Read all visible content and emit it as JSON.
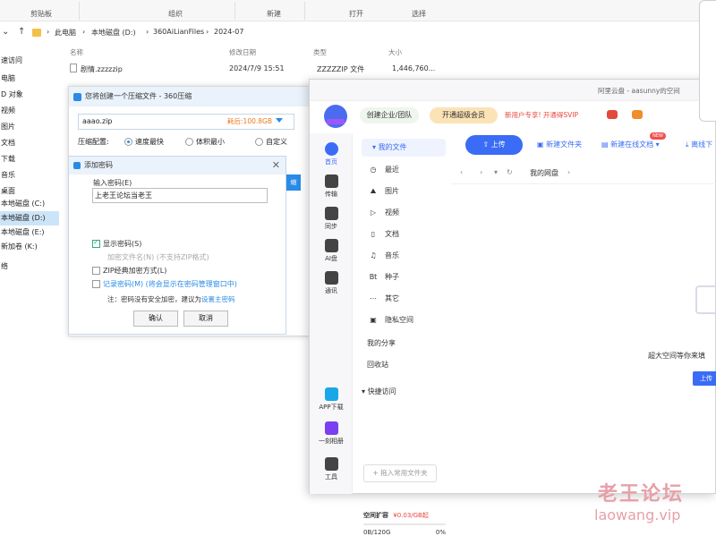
{
  "explorer": {
    "ribbon_groups": [
      "剪贴板",
      "组织",
      "新建",
      "打开",
      "选择"
    ],
    "breadcrumb": [
      "此电脑",
      "本地磁盘 (D:)",
      "360AiLianFiles",
      "2024-07"
    ],
    "tree": [
      "速访问",
      "电脑",
      "D 对象",
      "视频",
      "图片",
      "文档",
      "下载",
      "音乐",
      "桌面",
      "本地磁盘 (C:)",
      "本地磁盘 (D:)",
      "本地磁盘 (E:)",
      "新加卷 (K:)",
      "络"
    ],
    "columns": [
      "名称",
      "修改日期",
      "类型",
      "大小"
    ],
    "files": [
      {
        "name": "剧情.zzzzzip",
        "date": "2024/7/9 15:51",
        "type": "ZZZZZIP 文件",
        "size": "1,446,760..."
      }
    ]
  },
  "compress_dialog": {
    "title": "您将创建一个压缩文件 - 360压缩",
    "filename": "aaao.zip",
    "ratio": "耗后:100.8GB",
    "config_label": "压缩配置:",
    "options": [
      "速度最快",
      "体积最小",
      "自定义"
    ],
    "selected_option": "速度最快",
    "side_tab": "缩"
  },
  "password_dialog": {
    "title": "添加密码",
    "input_label": "输入密码(E)",
    "password_value": "上老王论坛当老王",
    "checks": [
      {
        "label": "显示密码(S)",
        "checked": true,
        "state": "normal"
      },
      {
        "label": "加密文件名(N) (不支持ZIP格式)",
        "checked": false,
        "state": "disabled"
      },
      {
        "label": "ZIP经典加密方式(L)",
        "checked": false,
        "state": "normal"
      },
      {
        "label": "记录密码(M) (将会显示在密码管理窗口中)",
        "checked": false,
        "state": "link"
      }
    ],
    "note_prefix": "注：密码没有安全加密，建议为",
    "note_link": "设置主密码",
    "ok_label": "确认",
    "cancel_label": "取消"
  },
  "pan": {
    "titlebar": "阿里云盘 - aasunny的空间",
    "header_pills": [
      "创建企业/团队",
      "开通超级会员",
      "新用户专享! 开通得SVIP"
    ],
    "rail": [
      "首页",
      "传输",
      "同步",
      "AI盘",
      "通讯",
      "APP下载",
      "一刻相册",
      "工具"
    ],
    "nav_head": "我的文件",
    "nav_items": [
      {
        "icon": "◷",
        "label": "最近"
      },
      {
        "icon": "⛰",
        "label": "图片"
      },
      {
        "icon": "▷",
        "label": "视频"
      },
      {
        "icon": "▯",
        "label": "文档"
      },
      {
        "icon": "♫",
        "label": "音乐"
      },
      {
        "icon": "Bt",
        "label": "种子"
      },
      {
        "icon": "⋯",
        "label": "其它"
      },
      {
        "icon": "▣",
        "label": "隐私空间"
      }
    ],
    "nav_sections": [
      "我的分享",
      "回收站"
    ],
    "quick_head": "快捷访问",
    "quick_add": "+ 拖入常用文件夹",
    "storage_label": "空间扩容",
    "storage_price": "¥0.03/GB起",
    "storage_used": "0B/120G",
    "storage_pct": "0%",
    "toolbar": {
      "upload": "上传",
      "new_folder": "新建文件夹",
      "new_online_doc": "新建在线文档",
      "new_badge": "NEW",
      "offline": "离线下"
    },
    "path": [
      "我的网盘",
      "›"
    ],
    "empty_text": "超大空间等你来填",
    "empty_btn": "上传"
  },
  "watermark": {
    "cn": "老王论坛",
    "en": "laowang.vip"
  }
}
